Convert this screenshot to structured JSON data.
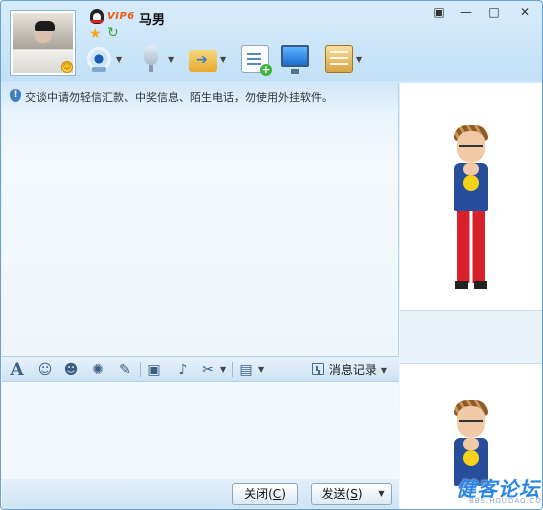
{
  "contact": {
    "nickname": "马男",
    "vip_label": "VIP6"
  },
  "window_controls": {
    "menu": "▣",
    "minimize": "—",
    "maximize": "□",
    "close": "✕"
  },
  "toolbar": {
    "items": [
      {
        "name": "video-call",
        "icon": "webcam-icon"
      },
      {
        "name": "voice-call",
        "icon": "microphone-icon"
      },
      {
        "name": "send-file",
        "icon": "folder-arrow-icon"
      },
      {
        "name": "group-chat",
        "icon": "chat-add-icon"
      },
      {
        "name": "remote-assist",
        "icon": "monitor-icon"
      },
      {
        "name": "apps",
        "icon": "app-box-icon"
      }
    ]
  },
  "notice": {
    "text": "交谈中请勿轻信汇款、中奖信息、陌生电话，勿使用外挂软件。"
  },
  "format_bar": {
    "font_glyph": "A",
    "history_label": "消息记录"
  },
  "buttons": {
    "close_label": "关闭(",
    "close_key": "C",
    "close_end": ")",
    "send_label": "发送(",
    "send_key": "S",
    "send_end": ")"
  },
  "watermark": {
    "text": "健客论坛",
    "sub": "BBS.HOUDAO.COM"
  },
  "colors": {
    "accent": "#2b86e8",
    "border": "#6aa1cf",
    "vip": "#f25b0c"
  }
}
